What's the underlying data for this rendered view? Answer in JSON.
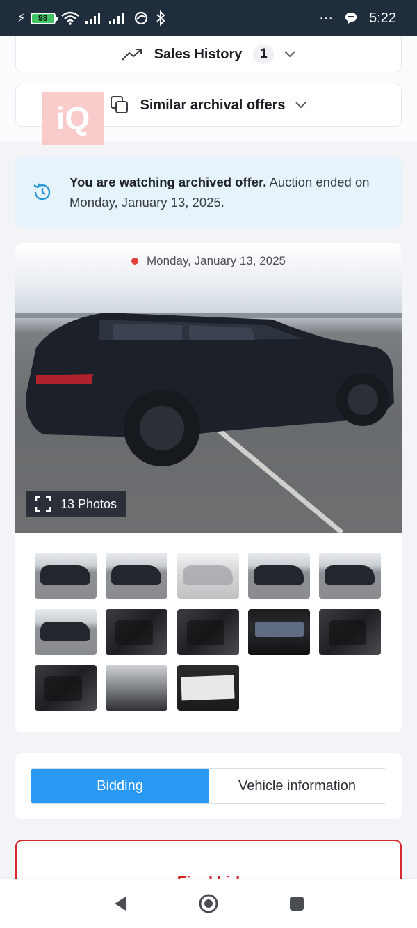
{
  "status_bar": {
    "battery": "98",
    "time": "5:22",
    "more": "···"
  },
  "sales_history": {
    "label": "Sales History",
    "count": "1"
  },
  "similar_offers": {
    "label": "Similar archival offers"
  },
  "logo": {
    "text": "iQ"
  },
  "archived_banner": {
    "bold_text": "You are watching archived offer.",
    "text": " Auction ended on Monday, January 13, 2025."
  },
  "gallery": {
    "date": "Monday, January 13, 2025",
    "photos_label": "13 Photos",
    "thumbnails": [
      {
        "kind": "exterior"
      },
      {
        "kind": "exterior"
      },
      {
        "kind": "exterior-white"
      },
      {
        "kind": "exterior"
      },
      {
        "kind": "exterior"
      },
      {
        "kind": "exterior"
      },
      {
        "kind": "interior"
      },
      {
        "kind": "interior"
      },
      {
        "kind": "dashboard"
      },
      {
        "kind": "interior"
      },
      {
        "kind": "interior"
      },
      {
        "kind": "engine"
      },
      {
        "kind": "label"
      }
    ]
  },
  "tabs": [
    {
      "label": "Bidding",
      "active": true
    },
    {
      "label": "Vehicle information",
      "active": false
    }
  ],
  "bid_card": {
    "title": "Final bid"
  },
  "colors": {
    "accent": "#2a98f5",
    "danger": "#d7282b",
    "banner_bg": "#e6f3fa",
    "status_bar": "#1f2d3d"
  }
}
